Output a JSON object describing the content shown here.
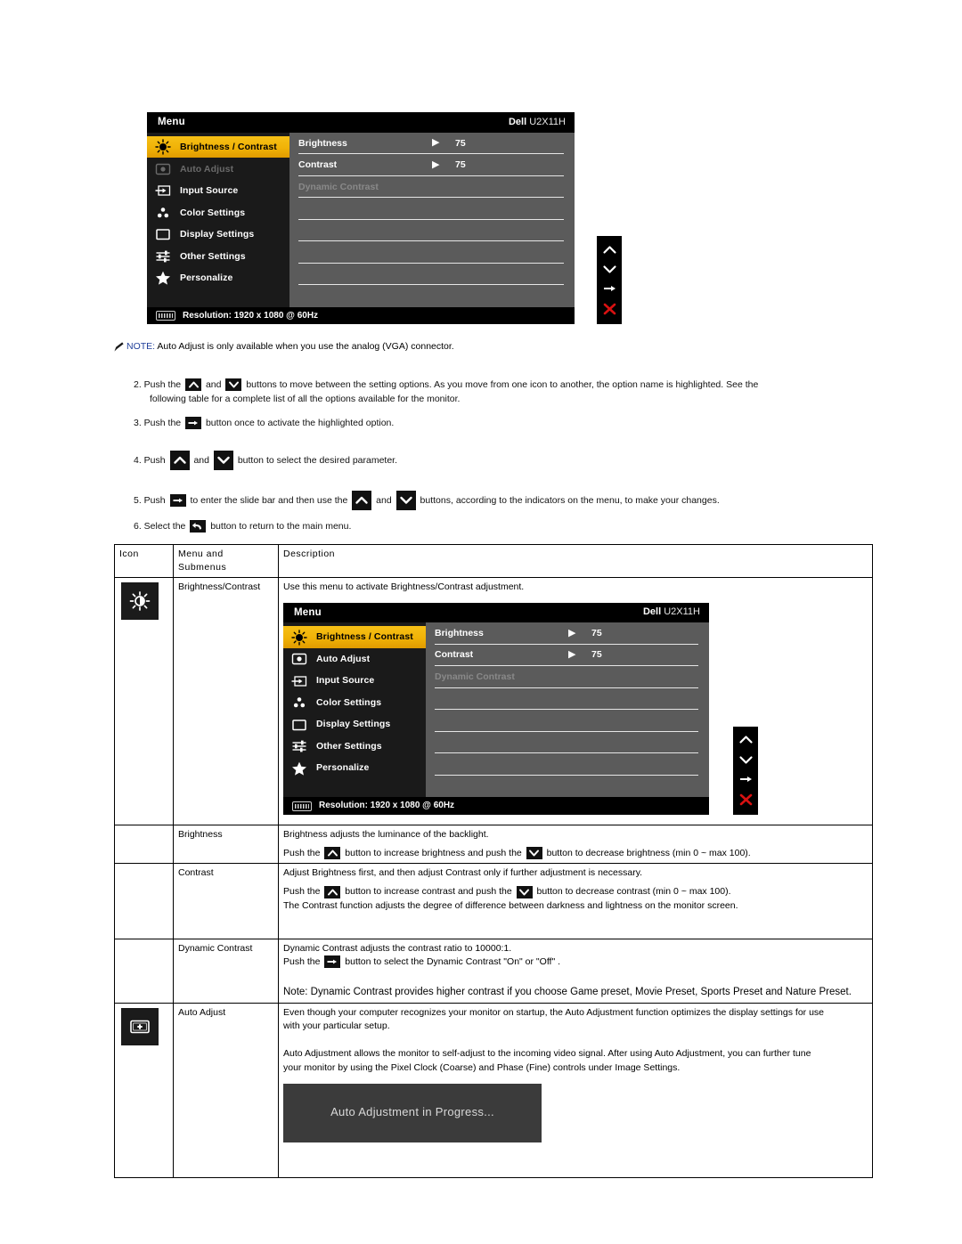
{
  "osd": {
    "title_left": "Menu",
    "brand": "Dell",
    "model": "U2X11H",
    "sidebar": [
      {
        "label": "Brightness / Contrast",
        "icon": "brightness-icon",
        "state": "selected"
      },
      {
        "label": "Auto Adjust",
        "icon": "auto-adjust-icon",
        "state": "dimmed"
      },
      {
        "label": "Input Source",
        "icon": "input-source-icon",
        "state": "normal"
      },
      {
        "label": "Color Settings",
        "icon": "color-settings-icon",
        "state": "normal"
      },
      {
        "label": "Display Settings",
        "icon": "display-settings-icon",
        "state": "normal"
      },
      {
        "label": "Other Settings",
        "icon": "other-settings-icon",
        "state": "normal"
      },
      {
        "label": "Personalize",
        "icon": "star-icon",
        "state": "normal"
      }
    ],
    "rows": [
      {
        "name": "Brightness",
        "arrow": "▶",
        "value": "75",
        "muted": false
      },
      {
        "name": "Contrast",
        "arrow": "▶",
        "value": "75",
        "muted": false
      },
      {
        "name": "Dynamic Contrast",
        "arrow": "",
        "value": "",
        "muted": true
      }
    ],
    "footer": "Resolution: 1920 x 1080 @ 60Hz",
    "nav": [
      "up-chevron-icon",
      "down-chevron-icon",
      "right-arrow-icon",
      "close-x-icon"
    ]
  },
  "osd2": {
    "title_left": "Menu",
    "brand": "Dell",
    "model": "U2X11H",
    "sidebar": [
      {
        "label": "Brightness / Contrast",
        "icon": "brightness-icon",
        "state": "selected"
      },
      {
        "label": "Auto Adjust",
        "icon": "auto-adjust-icon",
        "state": "normal"
      },
      {
        "label": "Input Source",
        "icon": "input-source-icon",
        "state": "normal"
      },
      {
        "label": "Color Settings",
        "icon": "color-settings-icon",
        "state": "normal"
      },
      {
        "label": "Display Settings",
        "icon": "display-settings-icon",
        "state": "normal"
      },
      {
        "label": "Other Settings",
        "icon": "other-settings-icon",
        "state": "normal"
      },
      {
        "label": "Personalize",
        "icon": "star-icon",
        "state": "normal"
      }
    ],
    "rows": [
      {
        "name": "Brightness",
        "arrow": "▶",
        "value": "75",
        "muted": false
      },
      {
        "name": "Contrast",
        "arrow": "▶",
        "value": "75",
        "muted": false
      },
      {
        "name": "Dynamic Contrast",
        "arrow": "",
        "value": "",
        "muted": true
      }
    ],
    "footer": "Resolution: 1920 x 1080 @ 60Hz"
  },
  "note": {
    "label": "NOTE:",
    "text": " Auto Adjust is only available when you use the analog (VGA) connector."
  },
  "steps": {
    "s2a": "2. Push the",
    "s2b": "and",
    "s2c": "buttons to move between the setting options. As you move from one icon to another, the option name is highlighted. See the",
    "s2d": "following table for a complete list of all the options available for the monitor.",
    "s3a": "3. Push the",
    "s3b": "button once to activate the highlighted option.",
    "s4a": "4. Push",
    "s4b": "and",
    "s4c": "button to select the desired parameter.",
    "s5a": "5. Push",
    "s5b": "to enter the slide bar and then use the",
    "s5c": "and",
    "s5d": "buttons, according to the indicators on the menu, to make your changes.",
    "s6a": "6. Select the",
    "s6b": "button to return to the main menu."
  },
  "table": {
    "headers": {
      "icon": "Icon",
      "menu": "Menu and Submenus",
      "menu_l1": "Icon",
      "description": "Description"
    },
    "rows": {
      "brightness_contrast": {
        "menu": "Brightness/Contrast",
        "desc": "Use this menu to activate Brightness/Contrast adjustment.",
        "icon": "brightness-icon"
      },
      "brightness": {
        "menu": "Brightness",
        "l1": "Brightness adjusts the luminance of the backlight.",
        "l2a": "Push the",
        "l2b": "button to increase brightness and push the",
        "l2c": "button to decrease brightness (min 0 ~ max 100)."
      },
      "contrast": {
        "menu": "Contrast",
        "l1": "Adjust Brightness first, and then adjust Contrast only if further adjustment is necessary.",
        "l2a": "Push the",
        "l2b": "button to increase contrast and push the",
        "l2c": "button to decrease contrast (min 0 ~  max 100).",
        "l3": "The Contrast function adjusts the degree of difference between darkness and lightness on the monitor screen."
      },
      "dynamic_contrast": {
        "menu": "Dynamic Contrast",
        "l1": "Dynamic Contrast adjusts the contrast ratio to 10000:1.",
        "l2a": "Push the",
        "l2b": "button to select the Dynamic Contrast \"On\" or \"Off\" .",
        "l3": "Note: Dynamic Contrast provides higher contrast if you choose Game preset, Movie Preset, Sports Preset and Nature Preset."
      },
      "auto_adjust": {
        "menu": "Auto Adjust",
        "icon": "auto-adjust-icon",
        "l1": "Even though your computer recognizes your monitor on startup, the Auto Adjustment function optimizes the display settings for use",
        "l2": "with your particular setup.",
        "l3": "Auto Adjustment allows the monitor to self-adjust to the incoming video signal. After using Auto Adjustment, you can further tune",
        "l4": "your monitor by using the Pixel Clock (Coarse) and Phase (Fine) controls under Image Settings.",
        "progress": "Auto Adjustment in Progress..."
      }
    }
  }
}
